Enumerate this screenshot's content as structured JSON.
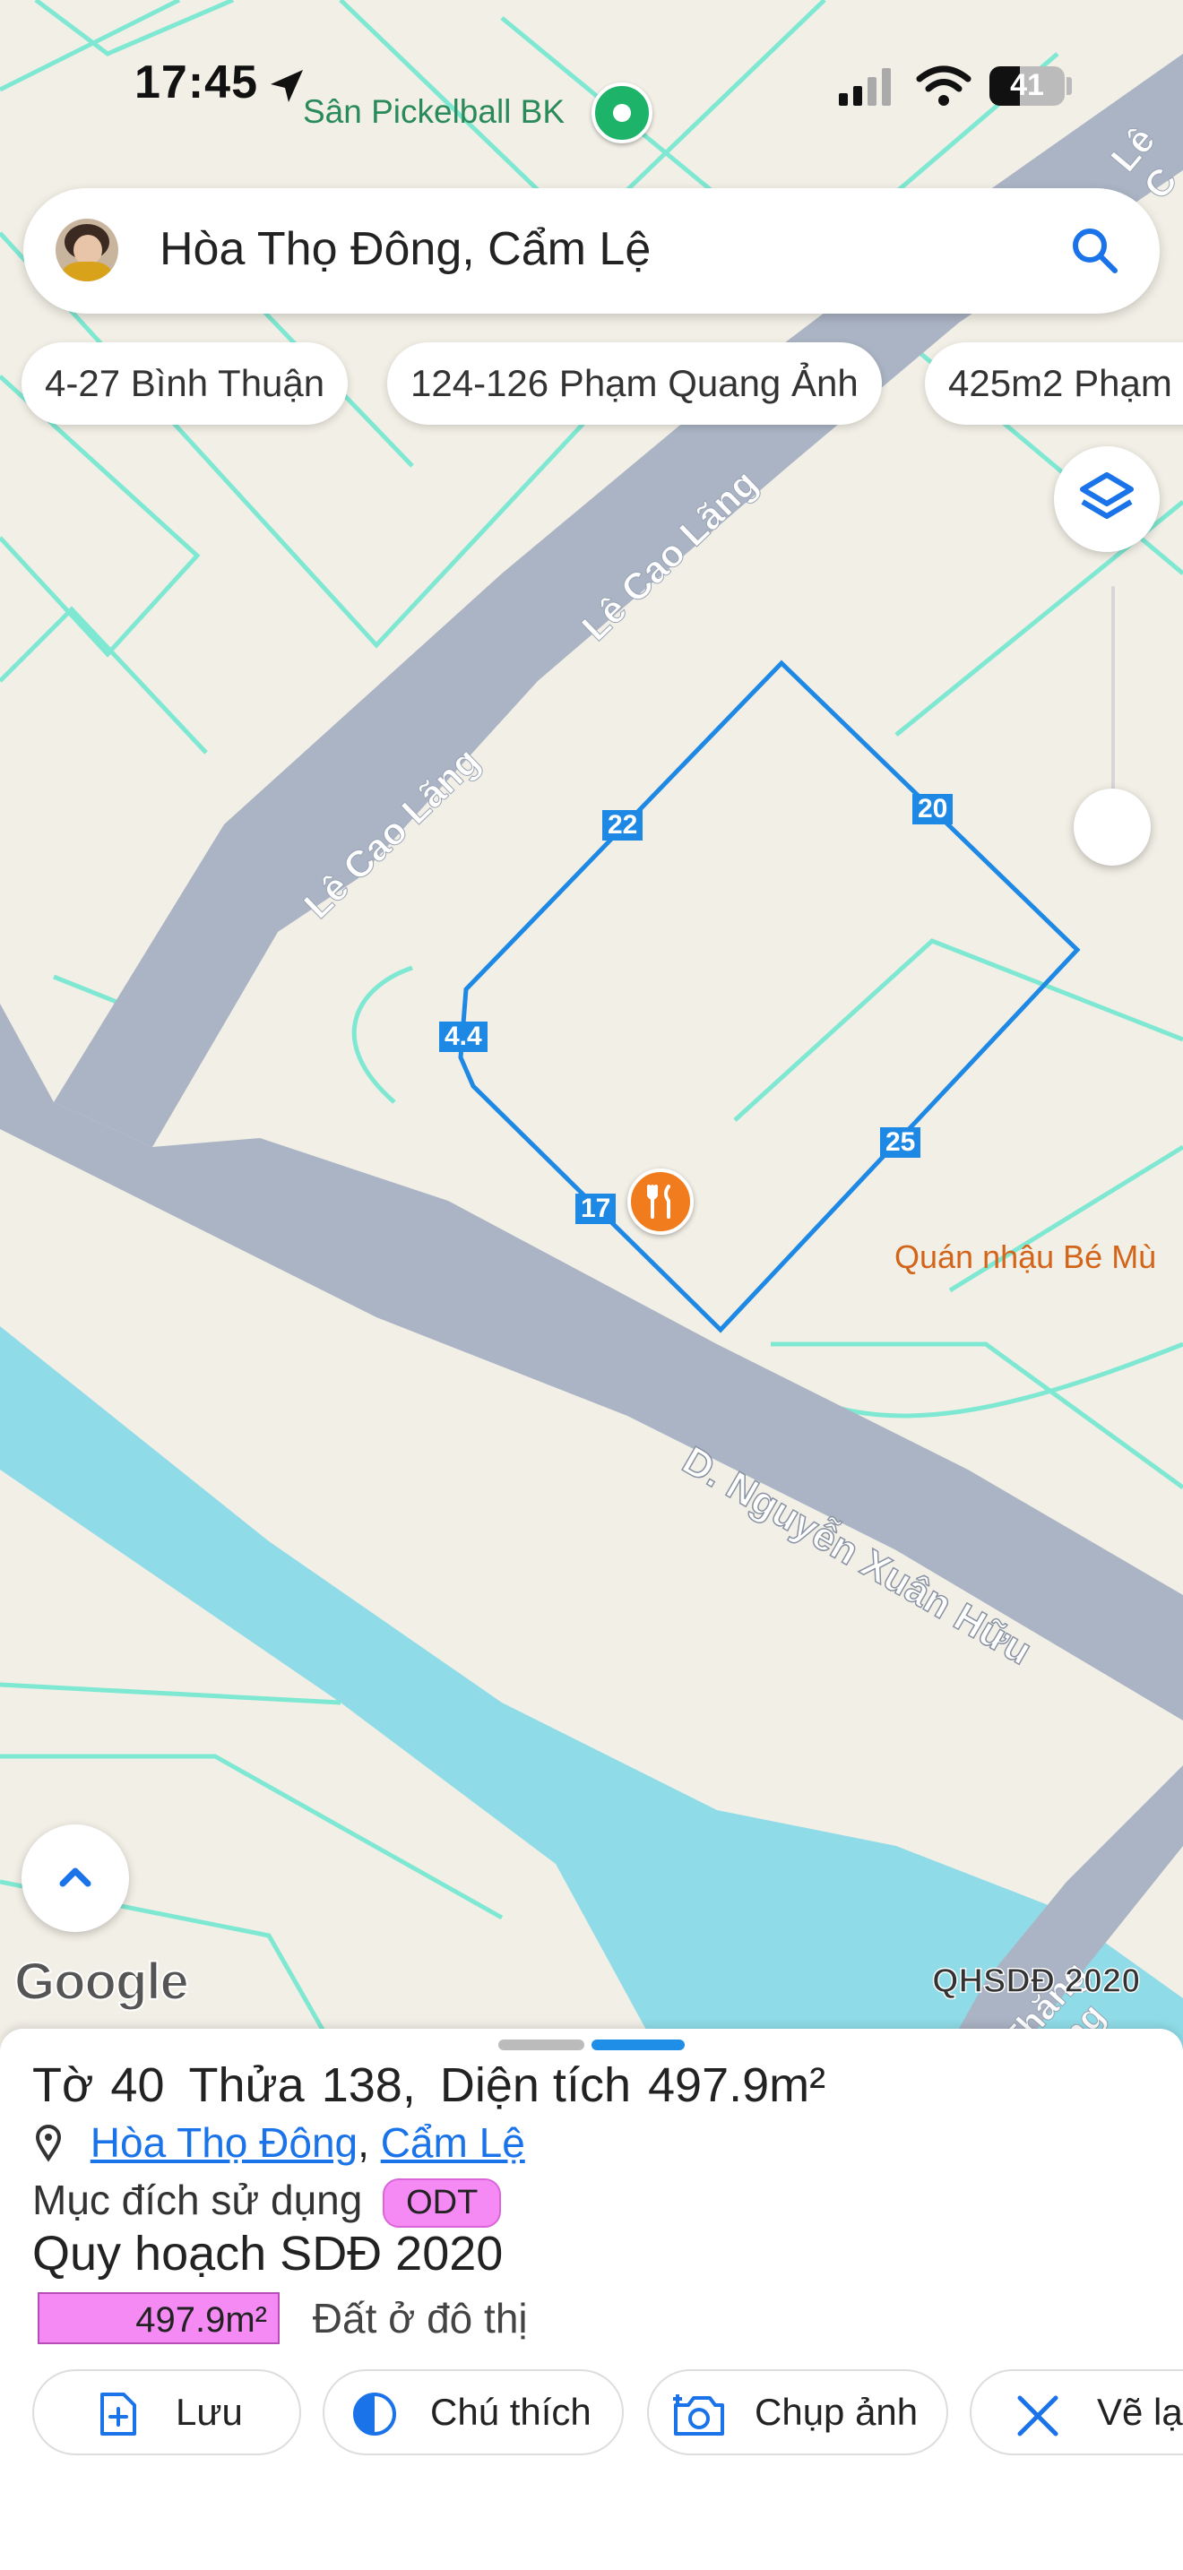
{
  "status_bar": {
    "time": "17:45",
    "battery": "41"
  },
  "map": {
    "pin_label": "Sân Pickelball BK",
    "roads": {
      "le_cao_lang_1": "Lê Cao Lãng",
      "le_cao_lang_2": "Lê Cao Lãng",
      "le_c_top": "Lê C",
      "nguyen_xuan_huu": "D. Nguyễn Xuân Hữu",
      "thang_long": "Thăng Long"
    },
    "poi_label": "Quán nhậu Bé Mù",
    "parcel_edges": [
      "22",
      "20",
      "4.4",
      "17",
      "25"
    ],
    "attribution": "Google",
    "layer_name": "QHSDĐ 2020"
  },
  "search": {
    "value": "Hòa Thọ Đông, Cẩm Lệ"
  },
  "chips": [
    "4-27 Bình Thuận",
    "124-126 Phạm Quang Ảnh",
    "425m2 Phạm"
  ],
  "sheet": {
    "to_label": "Tờ",
    "to_value": "40",
    "thua_label": "Thửa",
    "thua_value": "138",
    "area_label": "Diện tích",
    "area_value": "497.9m²",
    "ward": "Hòa Thọ Đông",
    "district": "Cẩm Lệ",
    "purpose_label": "Mục đích sử dụng",
    "purpose_code": "ODT",
    "plan_title": "Quy hoạch SDĐ 2020",
    "plan_area": "497.9m²",
    "plan_type": "Đất ở đô thị"
  },
  "actions": {
    "save": "Lưu",
    "legend": "Chú thích",
    "photo": "Chụp ảnh",
    "draw": "Vẽ lạ"
  },
  "colors": {
    "parcel": "#1e88e5",
    "road": "#aab4c4",
    "water": "#8fdce8",
    "lot_line": "#7fe8d2",
    "poi": "#f07c1e",
    "odt": "#f58af5"
  }
}
